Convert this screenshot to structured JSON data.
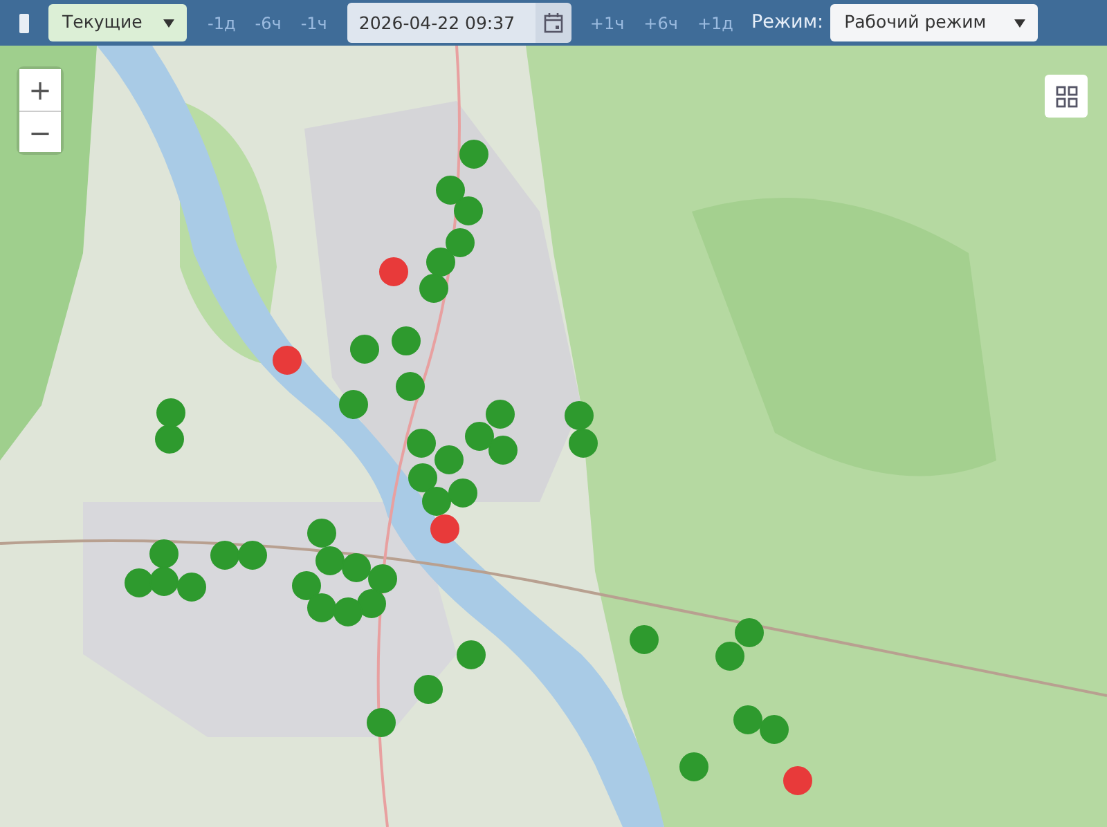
{
  "toolbar": {
    "period_select": {
      "value": "Текущие"
    },
    "step_back": [
      "-1д",
      "-6ч",
      "-1ч"
    ],
    "datetime": {
      "value": "2026-04-22 09:37"
    },
    "step_forward": [
      "+1ч",
      "+6ч",
      "+1д"
    ],
    "mode_label": "Режим:",
    "mode_select": {
      "value": "Рабочий режим"
    }
  },
  "map": {
    "zoom_controls": [
      "+",
      "−"
    ],
    "markers": [
      {
        "color": "#2e9a2e"
      },
      {
        "color": "#2e9a2e"
      },
      {
        "color": "#2e9a2e"
      },
      {
        "color": "#e83a3a"
      },
      {
        "color": "#2e9a2e"
      },
      {
        "color": "#2e9a2e"
      },
      {
        "color": "#2e9a2e"
      },
      {
        "color": "#e83a3a"
      },
      {
        "color": "#2e9a2e"
      },
      {
        "color": "#2e9a2e"
      },
      {
        "color": "#2e9a2e"
      },
      {
        "color": "#2e9a2e"
      },
      {
        "color": "#2e9a2e"
      },
      {
        "color": "#2e9a2e"
      },
      {
        "color": "#2e9a2e"
      },
      {
        "color": "#2e9a2e"
      },
      {
        "color": "#2e9a2e"
      },
      {
        "color": "#2e9a2e"
      },
      {
        "color": "#2e9a2e"
      },
      {
        "color": "#2e9a2e"
      },
      {
        "color": "#2e9a2e"
      },
      {
        "color": "#2e9a2e"
      },
      {
        "color": "#2e9a2e"
      },
      {
        "color": "#2e9a2e"
      },
      {
        "color": "#e83a3a"
      },
      {
        "color": "#2e9a2e"
      },
      {
        "color": "#2e9a2e"
      },
      {
        "color": "#2e9a2e"
      },
      {
        "color": "#2e9a2e"
      },
      {
        "color": "#2e9a2e"
      },
      {
        "color": "#2e9a2e"
      },
      {
        "color": "#2e9a2e"
      },
      {
        "color": "#2e9a2e"
      },
      {
        "color": "#2e9a2e"
      },
      {
        "color": "#2e9a2e"
      },
      {
        "color": "#2e9a2e"
      },
      {
        "color": "#2e9a2e"
      },
      {
        "color": "#2e9a2e"
      },
      {
        "color": "#2e9a2e"
      },
      {
        "color": "#2e9a2e"
      },
      {
        "color": "#2e9a2e"
      },
      {
        "color": "#2e9a2e"
      },
      {
        "color": "#2e9a2e"
      },
      {
        "color": "#2e9a2e"
      },
      {
        "color": "#2e9a2e"
      },
      {
        "color": "#2e9a2e"
      },
      {
        "color": "#2e9a2e"
      },
      {
        "color": "#2e9a2e"
      },
      {
        "color": "#e83a3a"
      }
    ]
  }
}
